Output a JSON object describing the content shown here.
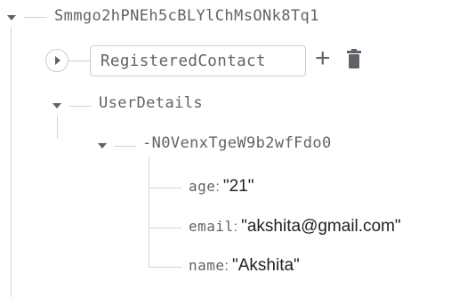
{
  "tree": {
    "root": {
      "key": "Smmgo2hPNEh5cBLYlChMsONk8Tq1",
      "expanded": true,
      "children": {
        "registered_contact": {
          "key": "RegisteredContact",
          "expanded": false,
          "actions": [
            {
              "name": "add",
              "label": "+",
              "icon": "plus-icon"
            },
            {
              "name": "delete",
              "icon": "trash-icon"
            }
          ]
        },
        "user_details": {
          "key": "UserDetails",
          "expanded": true,
          "child": {
            "key": "-N0VenxTgeW9b2wfFdo0",
            "expanded": true,
            "fields": [
              {
                "key": "age",
                "colon": ":",
                "value": "\"21\""
              },
              {
                "key": "email",
                "colon": ":",
                "value": "\"akshita@gmail.com\""
              },
              {
                "key": "name",
                "colon": ":",
                "value": "\"Akshita\""
              }
            ]
          }
        }
      }
    }
  },
  "colors": {
    "key_text": "#5f6368",
    "value_text": "#202124",
    "tree_line": "#cfd3d7",
    "icon": "#5f6368"
  }
}
